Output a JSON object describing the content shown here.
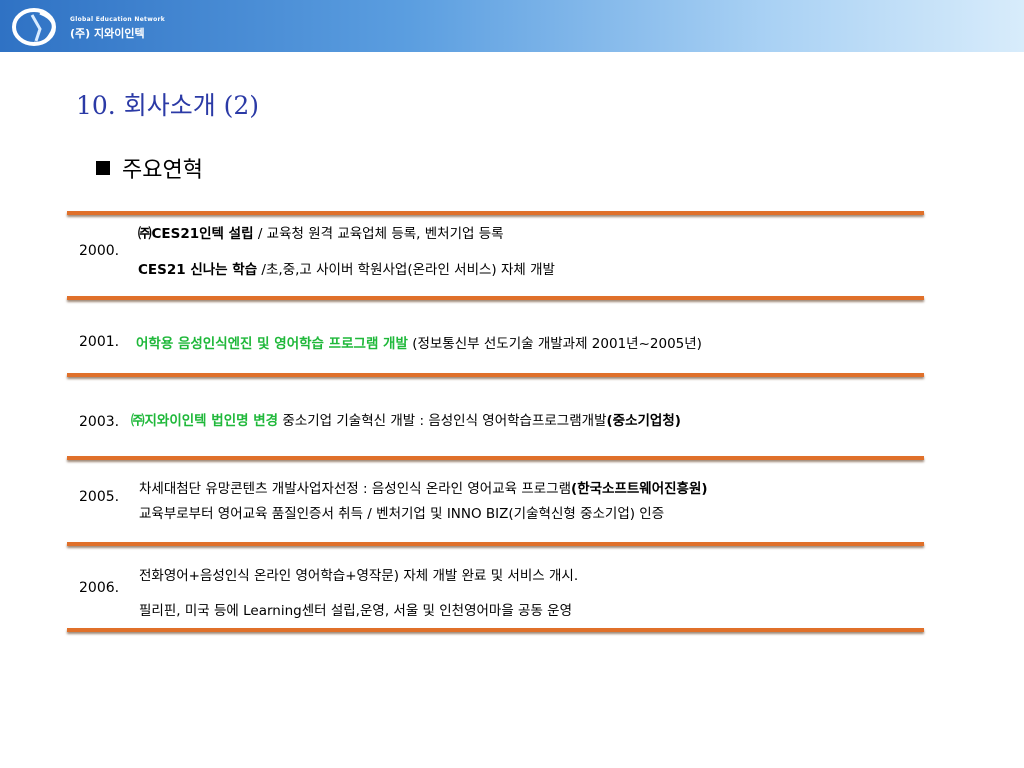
{
  "header": {
    "logo_tagline": "Global Education Network",
    "logo_company": "(주) 지와이인텍"
  },
  "title": "10. 회사소개 (2)",
  "section_heading": "주요연혁",
  "history": {
    "y2000": {
      "year": "2000.",
      "l1_bold": "㈜CES21인텍 설립",
      "l1_text": " / 교육청 원격 교육업체 등록, 벤처기업 등록",
      "l2_bold": "CES21 신나는 학습",
      "l2_text": " /초,중,고 사이버 학원사업(온라인 서비스) 자체 개발"
    },
    "y2001": {
      "year": "2001.",
      "l1_green": "어학용 음성인식엔진 및 영어학습 프로그램 개발",
      "l1_text": " (정보통신부 선도기술 개발과제 2001년~2005년)"
    },
    "y2003": {
      "year": "2003.",
      "l1_green": "㈜지와이인텍 법인명 변경",
      "l1_text": " 중소기업 기술혁신 개발 : 음성인식 영어학습프로그램개발",
      "l1_bold": "(중소기업청)"
    },
    "y2005": {
      "year": "2005.",
      "l1_text": "차세대첨단 유망콘텐츠 개발사업자선정 : 음성인식 온라인 영어교육 프로그램",
      "l1_bold": "(한국소프트웨어진흥원)",
      "l2_text": "교육부로부터 영어교육 품질인증서 취득 / 벤처기업 및  INNO BIZ(기술혁신형 중소기업) 인증"
    },
    "y2006": {
      "year": "2006.",
      "l1_text": "전화영어+음성인식 온라인 영어학습+영작문) 자체 개발 완료 및 서비스 개시.",
      "l2_text": "필리핀, 미국 등에 Learning센터 설립,운영, 서울 및 인천영어마을 공동 운영"
    }
  }
}
